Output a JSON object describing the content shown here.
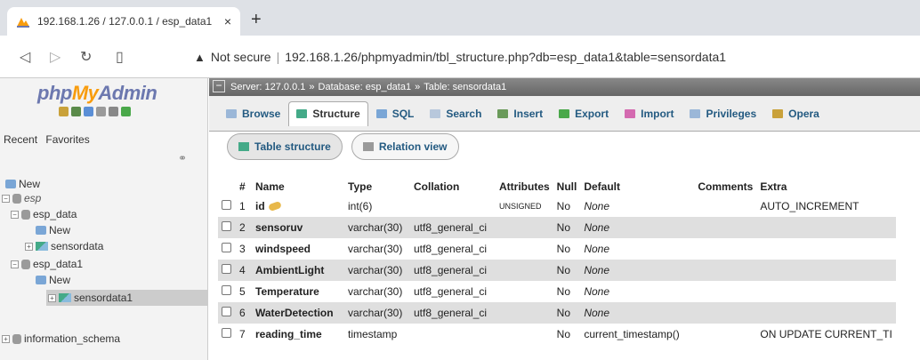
{
  "browser": {
    "tab_title": "192.168.1.26 / 127.0.0.1 / esp_data1",
    "tab_close": "×",
    "new_tab": "+",
    "security_label": "Not secure",
    "url": "192.168.1.26/phpmyadmin/tbl_structure.php?db=esp_data1&table=sensordata1"
  },
  "nav": {
    "logo_php": "php",
    "logo_my": "My",
    "logo_admin": "Admin",
    "tab_recent": "Recent",
    "tab_favorites": "Favorites",
    "tree": {
      "new_root": "New",
      "esp": "esp",
      "esp_data": "esp_data",
      "esp_data_new": "New",
      "esp_data_sensordata": "sensordata",
      "esp_data1": "esp_data1",
      "esp_data1_new": "New",
      "esp_data1_sensordata1": "sensordata1",
      "information_schema": "information_schema"
    }
  },
  "breadcrumb": {
    "server": "Server: 127.0.0.1",
    "database": "Database: esp_data1",
    "table": "Table: sensordata1",
    "separator": "»"
  },
  "menu": {
    "browse": "Browse",
    "structure": "Structure",
    "sql": "SQL",
    "search": "Search",
    "insert": "Insert",
    "export": "Export",
    "import": "Import",
    "privileges": "Privileges",
    "operations": "Opera"
  },
  "subtabs": {
    "table_structure": "Table structure",
    "relation_view": "Relation view"
  },
  "table": {
    "headers": {
      "num": "#",
      "name": "Name",
      "type": "Type",
      "collation": "Collation",
      "attributes": "Attributes",
      "null": "Null",
      "default": "Default",
      "comments": "Comments",
      "extra": "Extra"
    },
    "rows": [
      {
        "num": "1",
        "name": "id",
        "type": "int(6)",
        "collation": "",
        "attributes": "UNSIGNED",
        "null": "No",
        "default": "None",
        "comments": "",
        "extra": "AUTO_INCREMENT"
      },
      {
        "num": "2",
        "name": "sensoruv",
        "type": "varchar(30)",
        "collation": "utf8_general_ci",
        "attributes": "",
        "null": "No",
        "default": "None",
        "comments": "",
        "extra": ""
      },
      {
        "num": "3",
        "name": "windspeed",
        "type": "varchar(30)",
        "collation": "utf8_general_ci",
        "attributes": "",
        "null": "No",
        "default": "None",
        "comments": "",
        "extra": ""
      },
      {
        "num": "4",
        "name": "AmbientLight",
        "type": "varchar(30)",
        "collation": "utf8_general_ci",
        "attributes": "",
        "null": "No",
        "default": "None",
        "comments": "",
        "extra": ""
      },
      {
        "num": "5",
        "name": "Temperature",
        "type": "varchar(30)",
        "collation": "utf8_general_ci",
        "attributes": "",
        "null": "No",
        "default": "None",
        "comments": "",
        "extra": ""
      },
      {
        "num": "6",
        "name": "WaterDetection",
        "type": "varchar(30)",
        "collation": "utf8_general_ci",
        "attributes": "",
        "null": "No",
        "default": "None",
        "comments": "",
        "extra": ""
      },
      {
        "num": "7",
        "name": "reading_time",
        "type": "timestamp",
        "collation": "",
        "attributes": "",
        "null": "No",
        "default": "current_timestamp()",
        "comments": "",
        "extra": "ON UPDATE CURRENT_TI"
      }
    ]
  },
  "colors": {
    "link_blue": "#235a81",
    "logo_blue": "#6c78af",
    "logo_orange": "#f89c0e",
    "row_alt": "#dfdfdf"
  }
}
